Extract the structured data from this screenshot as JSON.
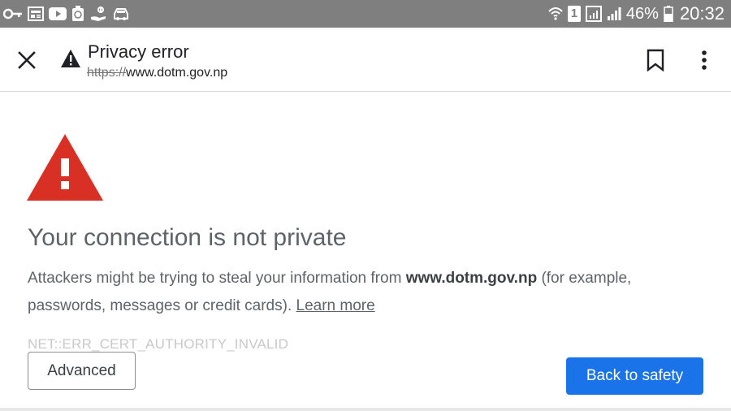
{
  "status_bar": {
    "left_icons": [
      "key-icon",
      "news-icon",
      "youtube-icon",
      "recycle-icon",
      "hand-icon",
      "car-icon"
    ],
    "right_icons": [
      "wifi-icon",
      "sim1-icon",
      "signal-icon",
      "signal-2-icon",
      "battery-icon"
    ],
    "sim_label": "1",
    "battery_percent": "46%",
    "time": "20:32",
    "background": "#7f7f7f"
  },
  "toolbar": {
    "title": "Privacy error",
    "url_scheme": "https://",
    "url_host": "www.dotm.gov.np",
    "close_icon": "close-icon",
    "warning_icon": "warning-icon",
    "bookmark_icon": "bookmark-icon",
    "menu_icon": "more-vert-icon"
  },
  "content": {
    "warning_icon": "warning-triangle-icon",
    "warning_color": "#d93025",
    "heading": "Your connection is not private",
    "body_part1": "Attackers might be trying to steal your information from ",
    "body_host": "www.dotm.gov.np",
    "body_part2": " (for example, passwords, messages or credit cards). ",
    "learn_more": "Learn more",
    "error_code": "NET::ERR_CERT_AUTHORITY_INVALID"
  },
  "buttons": {
    "advanced": "Advanced",
    "back_to_safety": "Back to safety",
    "primary_color": "#1a73e8"
  }
}
